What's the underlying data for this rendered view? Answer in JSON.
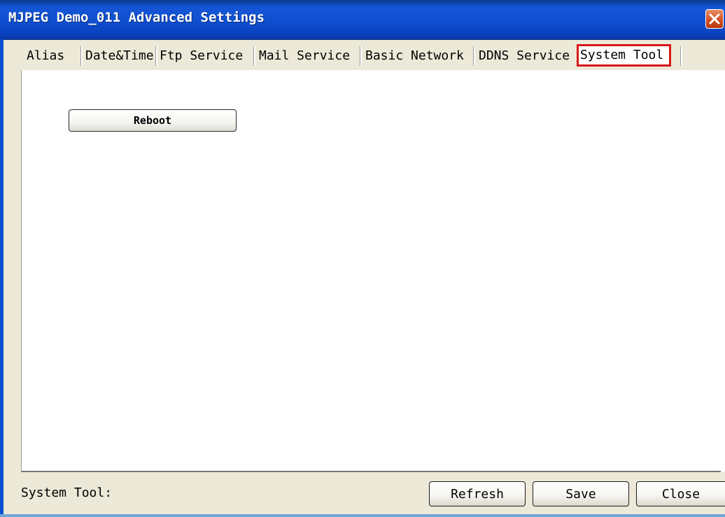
{
  "window": {
    "title": "MJPEG Demo_011 Advanced Settings"
  },
  "tabs": [
    {
      "label": "Alias",
      "active": false
    },
    {
      "label": "Date&Time",
      "active": false
    },
    {
      "label": "Ftp Service",
      "active": false
    },
    {
      "label": "Mail Service",
      "active": false
    },
    {
      "label": "Basic Network",
      "active": false
    },
    {
      "label": "DDNS Service",
      "active": false
    },
    {
      "label": "System Tool",
      "active": true
    }
  ],
  "panel": {
    "reboot_label": "Reboot"
  },
  "footer": {
    "status_text": "System Tool:",
    "refresh_label": "Refresh",
    "save_label": "Save",
    "close_label": "Close"
  },
  "colors": {
    "active_tab_highlight": "#d81818",
    "titlebar": "#0e4fd0"
  }
}
